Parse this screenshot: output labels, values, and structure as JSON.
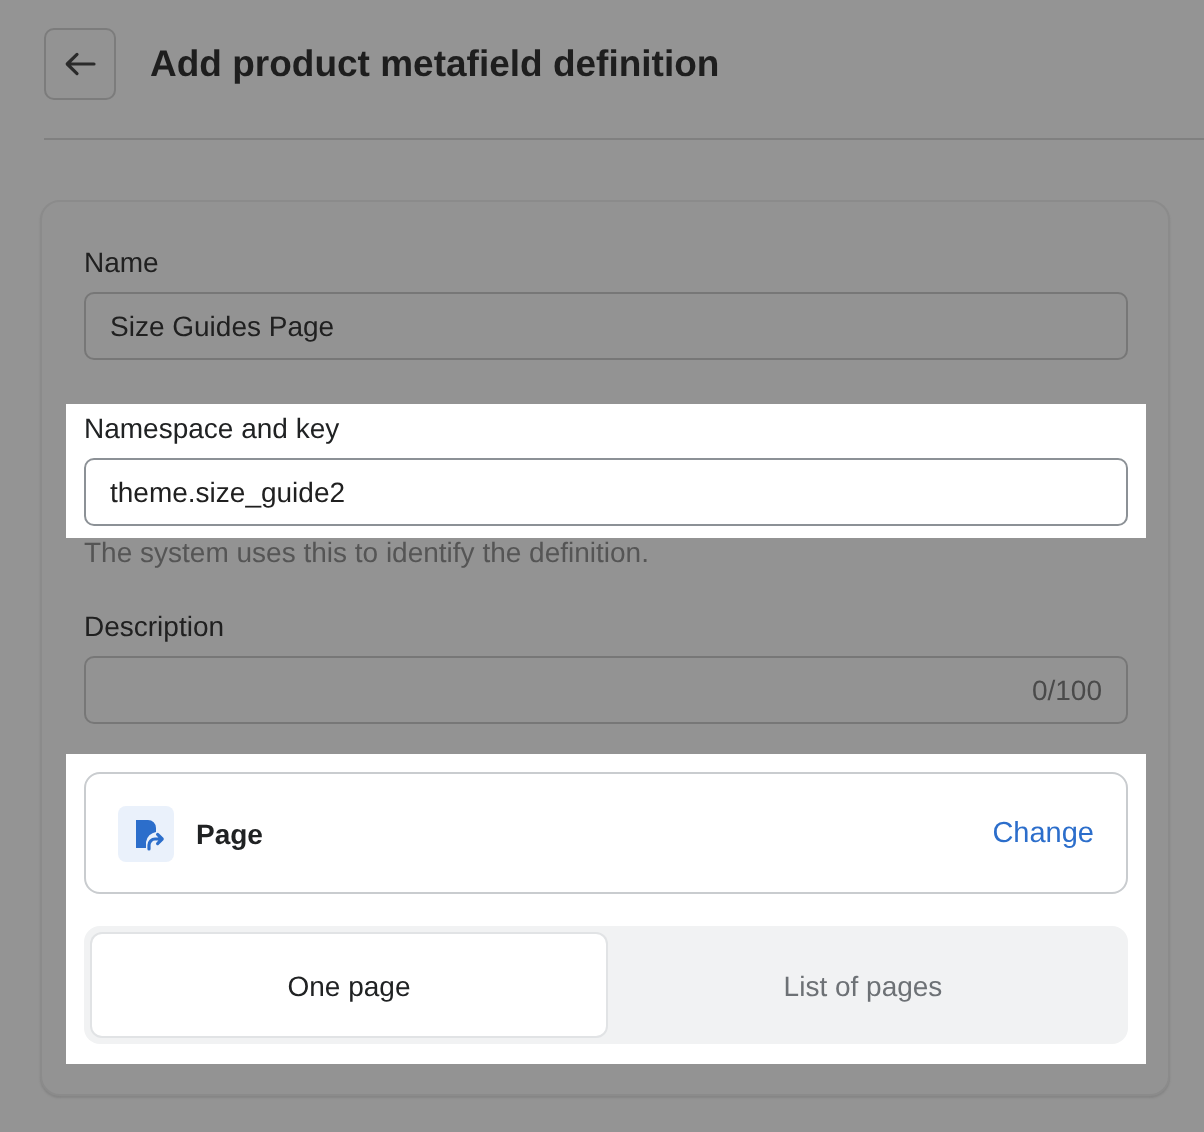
{
  "header": {
    "title": "Add product metafield definition"
  },
  "form": {
    "fields": [
      {
        "kind": "text",
        "label": "Name",
        "value": "Size Guides Page",
        "highlighted": false
      },
      {
        "kind": "text",
        "label": "Namespace and key",
        "value": "theme.size_guide2",
        "help": "The system uses this to identify the definition.",
        "highlighted": true
      },
      {
        "kind": "counter",
        "label": "Description",
        "counter": "0/100",
        "highlighted": false
      }
    ],
    "type_section": {
      "highlighted": true,
      "type_name": "Page",
      "action": "Change",
      "options": [
        {
          "label": "One page",
          "selected": true
        },
        {
          "label": "List of pages",
          "selected": false
        }
      ]
    }
  }
}
